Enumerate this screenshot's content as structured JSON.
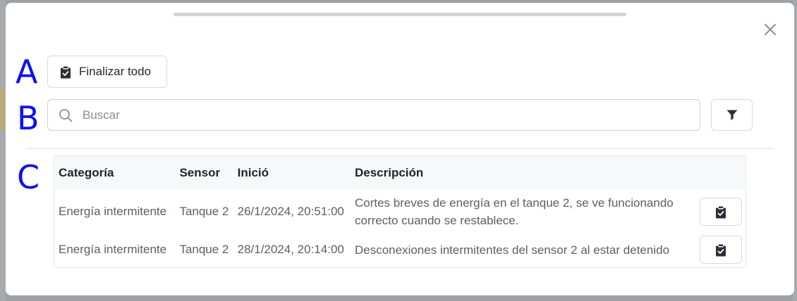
{
  "markers": [
    "A",
    "B",
    "C"
  ],
  "toolbar": {
    "finalize_all_label": "Finalizar todo"
  },
  "search": {
    "placeholder": "Buscar",
    "value": ""
  },
  "table": {
    "headers": [
      "Categoría",
      "Sensor",
      "Inició",
      "Descripción"
    ],
    "rows": [
      {
        "category": "Energía intermitente",
        "sensor": "Tanque 2",
        "started": "26/1/2024, 20:51:00",
        "description": "Cortes breves de energía en el tanque 2, se ve funcionando correcto cuando se restablece."
      },
      {
        "category": "Energía intermitente",
        "sensor": "Tanque 2",
        "started": "28/1/2024, 20:14:00",
        "description": "Desconexiones intermitentes del sensor 2 al estar detenido"
      }
    ]
  },
  "icons": {
    "close": "close-icon",
    "finalize": "clipboard-check-icon",
    "search": "search-icon",
    "filter": "filter-icon"
  },
  "colors": {
    "marker": "#1010ee",
    "text_primary": "#1f2226",
    "text_secondary": "#5b5f65",
    "border": "#d7d9dc",
    "header_bg": "#f7f8fa"
  }
}
